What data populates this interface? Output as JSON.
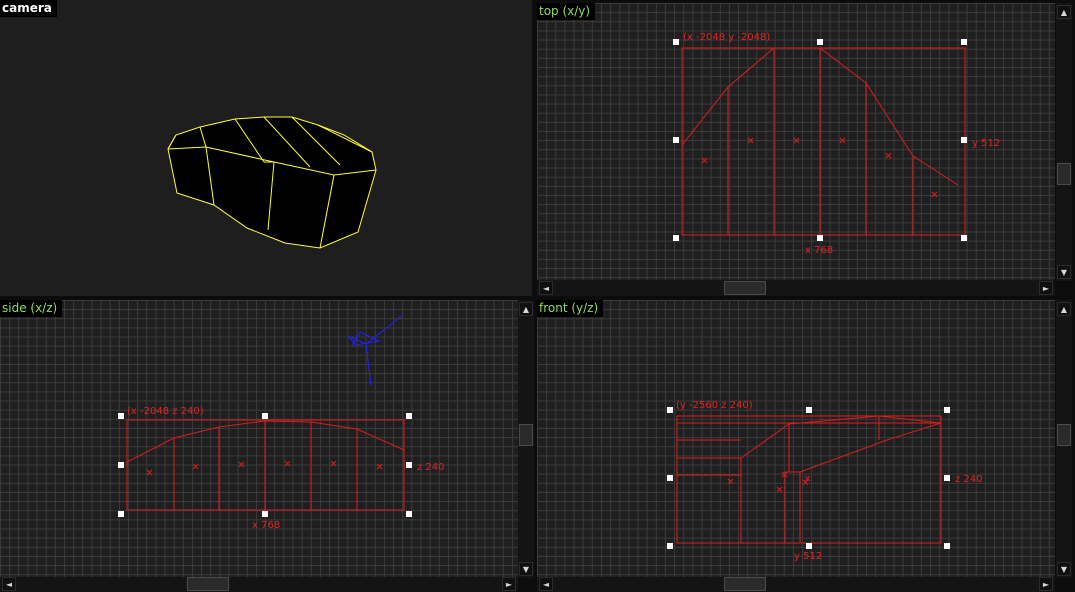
{
  "viewports": {
    "camera": {
      "label": "camera"
    },
    "top": {
      "label": "top (x/y)",
      "coord_origin": "(x -2048 y -2048)",
      "coord_height": "y 512",
      "coord_width": "x 768"
    },
    "side": {
      "label": "side (x/z)",
      "coord_origin": "(x -2048 z 240)",
      "coord_height": "z 240",
      "coord_width": "x 768"
    },
    "front": {
      "label": "front (y/z)",
      "coord_origin": "(y -2560 z 240)",
      "coord_height": "z 240",
      "coord_width": "y 512"
    }
  },
  "scroll_arrows": {
    "up": "▲",
    "down": "▼",
    "left": "◄",
    "right": "►"
  },
  "colors": {
    "grid_background": "#1f1f1f",
    "grid_line": "#3c3c3c",
    "brush_selected": "#dd1c1c",
    "camera_wire": "#ffff33",
    "entity": "#2323ff",
    "label_ortho": "#8fdc5a"
  },
  "icons": {
    "handle": "selection-handle-square",
    "center": "brush-center-cross"
  }
}
